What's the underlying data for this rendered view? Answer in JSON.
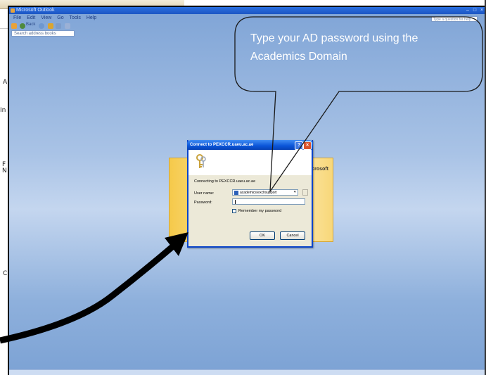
{
  "background_doc": {
    "fragments": [
      "A",
      "In",
      "F",
      "N",
      "C"
    ]
  },
  "window": {
    "title": "Microsoft Outlook",
    "menu": [
      "File",
      "Edit",
      "View",
      "Go",
      "Tools",
      "Help"
    ],
    "toolbar": {
      "back_label": "Back"
    },
    "address_search_placeholder": "Search address books",
    "help_placeholder": "Type a question for help"
  },
  "splash": {
    "brand": "Microsoft"
  },
  "dialog": {
    "title": "Connect to PEXCCR.uaeu.ac.ae",
    "connecting_text": "Connecting to PEXCCR.uaeu.ac.ae",
    "user_name_label": "User name:",
    "user_name_value": "academics\\exchsupport",
    "password_label": "Password:",
    "remember_label": "Remember my password",
    "ok_label": "OK",
    "cancel_label": "Cancel"
  },
  "callout": {
    "text": "Type your AD password  using the Academics Domain"
  },
  "colors": {
    "window_gradient_top": "#7fa4d6",
    "titlebar": "#1c56c4",
    "dialog_face": "#ece9d8",
    "splash": "#f5c94a",
    "arrow": "#000000"
  }
}
